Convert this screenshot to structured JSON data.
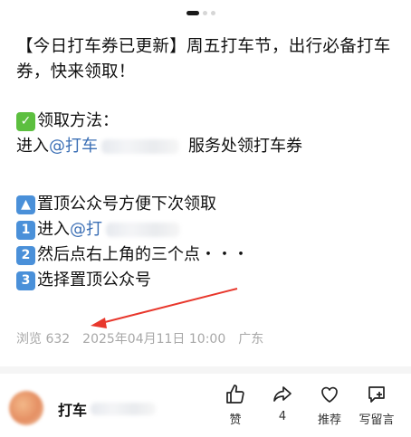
{
  "article": {
    "title": "【今日打车券已更新】周五打车节，出行必备打车券，快来领取！",
    "method_label": "领取方法：",
    "method_prefix": "进入",
    "mention_1": "@打车",
    "method_suffix": "服务处领打车券",
    "step1": "置顶公众号方便下次领取",
    "step2_prefix": "进入",
    "mention_2": "@打",
    "step3": "然后点右上角的三个点・・・",
    "step4": "选择置顶公众号"
  },
  "meta": {
    "views": "浏览 632",
    "datetime": "2025年04月11日 10:00",
    "location": "广东"
  },
  "author": {
    "name": "打车"
  },
  "actions": {
    "like_label": "赞",
    "share_count": "4",
    "recommend_label": "推荐",
    "comment_label": "写留言"
  },
  "icons": {
    "check": "check-mark-emoji",
    "up": "up-arrow-emoji",
    "num1": "keycap-1-emoji",
    "num2": "keycap-2-emoji",
    "num3": "keycap-3-emoji"
  },
  "colors": {
    "mention": "#3b6fb5",
    "meta": "#a7a7a7",
    "annotation_arrow": "#e8372c"
  }
}
